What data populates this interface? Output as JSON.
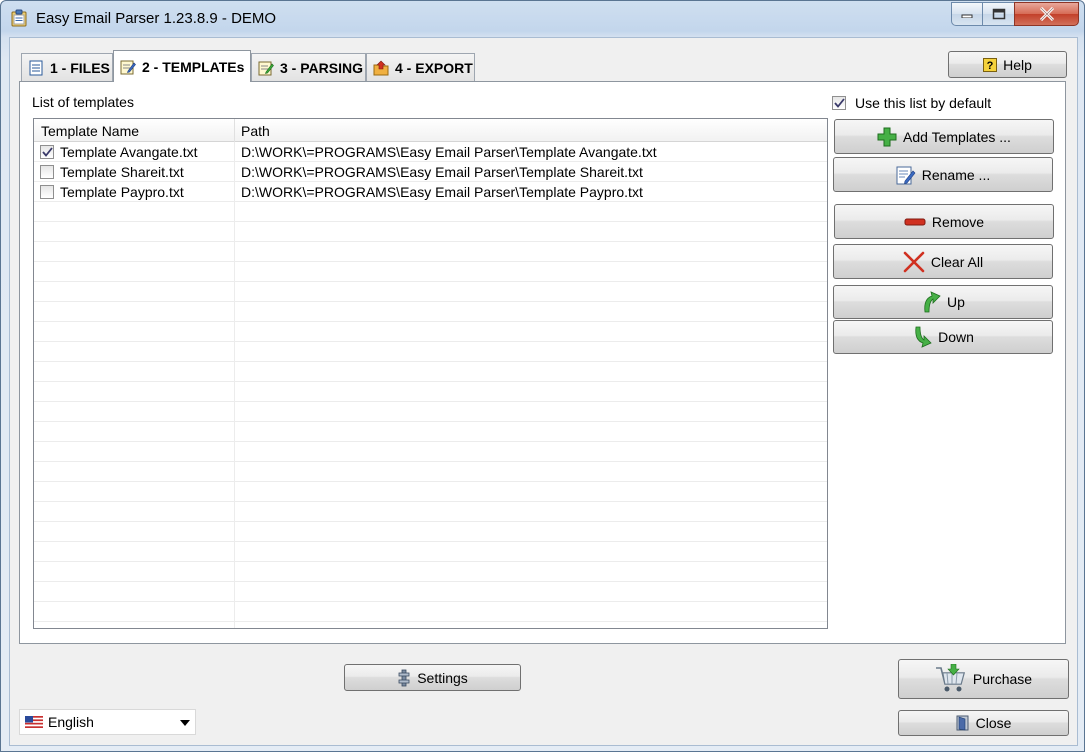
{
  "window": {
    "title": "Easy Email Parser 1.23.8.9 - DEMO"
  },
  "tabs": [
    {
      "label": "1 - FILES",
      "icon": "document-list-icon"
    },
    {
      "label": "2 - TEMPLATEs",
      "icon": "template-edit-icon",
      "active": true
    },
    {
      "label": "3 - PARSING",
      "icon": "parse-edit-icon"
    },
    {
      "label": "4 - EXPORT",
      "icon": "export-folder-icon"
    }
  ],
  "help_label": "Help",
  "templates": {
    "list_label": "List of templates",
    "default_checkbox_label": "Use this list by default",
    "default_checked": true,
    "columns": [
      "Template Name",
      "Path"
    ],
    "rows": [
      {
        "name": "Template Avangate.txt",
        "path": "D:\\WORK\\=PROGRAMS\\Easy Email Parser\\Template Avangate.txt",
        "checked": true
      },
      {
        "name": "Template Shareit.txt",
        "path": "D:\\WORK\\=PROGRAMS\\Easy Email Parser\\Template Shareit.txt",
        "checked": false
      },
      {
        "name": "Template Paypro.txt",
        "path": "D:\\WORK\\=PROGRAMS\\Easy Email Parser\\Template Paypro.txt",
        "checked": false
      }
    ]
  },
  "actions": {
    "add": "Add Templates ...",
    "rename": "Rename ...",
    "remove": "Remove",
    "clear": "Clear All",
    "up": "Up",
    "down": "Down"
  },
  "footer": {
    "settings": "Settings",
    "purchase": "Purchase",
    "close": "Close",
    "language": "English"
  },
  "colors": {
    "accent_green": "#3aa83a",
    "remove_red": "#d03020",
    "help_yellow": "#f5d23c"
  }
}
